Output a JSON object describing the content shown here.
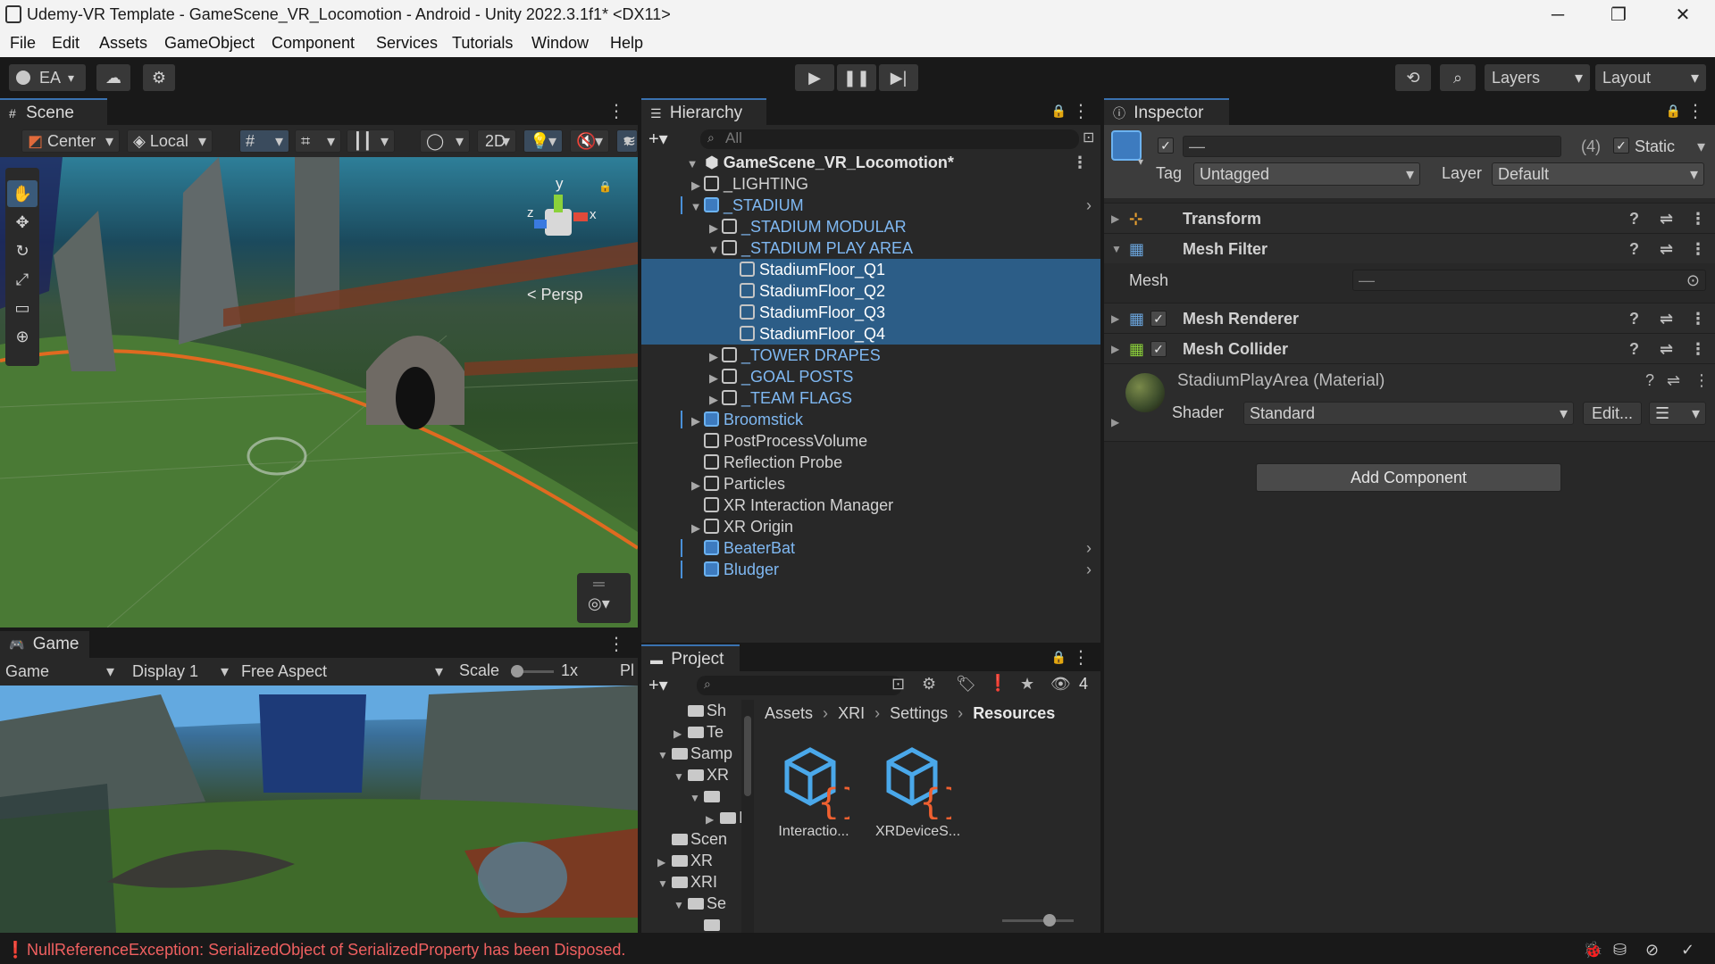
{
  "window": {
    "title": "Udemy-VR Template - GameScene_VR_Locomotion - Android - Unity 2022.3.1f1* <DX11>",
    "minimize": "─",
    "maximize": "❐",
    "close": "✕"
  },
  "menu": [
    "File",
    "Edit",
    "Assets",
    "GameObject",
    "Component",
    "Services",
    "Tutorials",
    "Window",
    "Help"
  ],
  "toolbar": {
    "account": "EA",
    "layers": "Layers",
    "layout": "Layout"
  },
  "scene": {
    "tab": "Scene",
    "pivot": "Center",
    "space": "Local",
    "mode_2d": "2D",
    "persp": "< Persp",
    "axis_y": "y",
    "axis_x": "x",
    "axis_z": "z"
  },
  "game": {
    "tab": "Game",
    "view": "Game",
    "display": "Display 1",
    "aspect": "Free Aspect",
    "scale_label": "Scale",
    "scale_value": "1x",
    "play_label": "Pl"
  },
  "hierarchy": {
    "tab": "Hierarchy",
    "search_placeholder": "All",
    "scene": "GameScene_VR_Locomotion*",
    "items": [
      {
        "label": "_LIGHTING",
        "indent": 1,
        "arrow": "▶",
        "color": "#d2d2d2",
        "blue": false,
        "sel": false,
        "more": false
      },
      {
        "label": "_STADIUM",
        "indent": 1,
        "arrow": "▼",
        "color": "#7fb8f2",
        "blue": true,
        "sel": false,
        "more": true
      },
      {
        "label": "_STADIUM MODULAR",
        "indent": 2,
        "arrow": "▶",
        "color": "#7fb8f2",
        "blue": false,
        "sel": false,
        "more": false
      },
      {
        "label": "_STADIUM PLAY AREA",
        "indent": 2,
        "arrow": "▼",
        "color": "#7fb8f2",
        "blue": false,
        "sel": false,
        "more": false
      },
      {
        "label": "StadiumFloor_Q1",
        "indent": 3,
        "arrow": "",
        "color": "#ffffff",
        "blue": false,
        "sel": true,
        "more": false
      },
      {
        "label": "StadiumFloor_Q2",
        "indent": 3,
        "arrow": "",
        "color": "#ffffff",
        "blue": false,
        "sel": true,
        "more": false
      },
      {
        "label": "StadiumFloor_Q3",
        "indent": 3,
        "arrow": "",
        "color": "#ffffff",
        "blue": false,
        "sel": true,
        "more": false
      },
      {
        "label": "StadiumFloor_Q4",
        "indent": 3,
        "arrow": "",
        "color": "#ffffff",
        "blue": false,
        "sel": true,
        "more": false
      },
      {
        "label": "_TOWER DRAPES",
        "indent": 2,
        "arrow": "▶",
        "color": "#7fb8f2",
        "blue": false,
        "sel": false,
        "more": false
      },
      {
        "label": "_GOAL POSTS",
        "indent": 2,
        "arrow": "▶",
        "color": "#7fb8f2",
        "blue": false,
        "sel": false,
        "more": false
      },
      {
        "label": "_TEAM FLAGS",
        "indent": 2,
        "arrow": "▶",
        "color": "#7fb8f2",
        "blue": false,
        "sel": false,
        "more": false
      },
      {
        "label": "Broomstick",
        "indent": 1,
        "arrow": "▶",
        "color": "#7fb8f2",
        "blue": true,
        "sel": false,
        "more": false
      },
      {
        "label": "PostProcessVolume",
        "indent": 1,
        "arrow": "",
        "color": "#d2d2d2",
        "blue": false,
        "sel": false,
        "more": false
      },
      {
        "label": "Reflection Probe",
        "indent": 1,
        "arrow": "",
        "color": "#d2d2d2",
        "blue": false,
        "sel": false,
        "more": false
      },
      {
        "label": "Particles",
        "indent": 1,
        "arrow": "▶",
        "color": "#d2d2d2",
        "blue": false,
        "sel": false,
        "more": false
      },
      {
        "label": "XR Interaction Manager",
        "indent": 1,
        "arrow": "",
        "color": "#d2d2d2",
        "blue": false,
        "sel": false,
        "more": false
      },
      {
        "label": "XR Origin",
        "indent": 1,
        "arrow": "▶",
        "color": "#d2d2d2",
        "blue": false,
        "sel": false,
        "more": false
      },
      {
        "label": "BeaterBat",
        "indent": 1,
        "arrow": "",
        "color": "#7fb8f2",
        "blue": true,
        "sel": false,
        "more": true
      },
      {
        "label": "Bludger",
        "indent": 1,
        "arrow": "",
        "color": "#7fb8f2",
        "blue": true,
        "sel": false,
        "more": true
      }
    ]
  },
  "inspector": {
    "tab": "Inspector",
    "name_value": "—",
    "count": "(4)",
    "static_label": "Static",
    "tag_label": "Tag",
    "tag_value": "Untagged",
    "layer_label": "Layer",
    "layer_value": "Default",
    "components": [
      "Transform",
      "Mesh Filter",
      "Mesh Renderer",
      "Mesh Collider"
    ],
    "mesh_label": "Mesh",
    "mesh_value": "—",
    "material_name": "StadiumPlayArea (Material)",
    "shader_label": "Shader",
    "shader_value": "Standard",
    "edit_label": "Edit...",
    "add_component": "Add Component"
  },
  "project": {
    "tab": "Project",
    "hidden_count": "4",
    "breadcrumb": [
      "Assets",
      "XRI",
      "Settings",
      "Resources"
    ],
    "tree": [
      {
        "label": "Sh",
        "indent": 2,
        "arrow": ""
      },
      {
        "label": "Te",
        "indent": 2,
        "arrow": "▶"
      },
      {
        "label": "Samp",
        "indent": 1,
        "arrow": "▼"
      },
      {
        "label": "XR",
        "indent": 2,
        "arrow": "▼"
      },
      {
        "label": "",
        "indent": 3,
        "arrow": "▼"
      },
      {
        "label": "I",
        "indent": 4,
        "arrow": "▶"
      },
      {
        "label": "Scen",
        "indent": 1,
        "arrow": ""
      },
      {
        "label": "XR",
        "indent": 1,
        "arrow": "▶"
      },
      {
        "label": "XRI",
        "indent": 1,
        "arrow": "▼"
      },
      {
        "label": "Se",
        "indent": 2,
        "arrow": "▼"
      },
      {
        "label": "",
        "indent": 3,
        "arrow": ""
      }
    ],
    "assets": [
      "Interactio...",
      "XRDeviceS..."
    ]
  },
  "status": {
    "message": "NullReferenceException: SerializedObject of SerializedProperty has been Disposed."
  },
  "colors": {
    "accent": "#3a72b0",
    "selection": "#2c5d87",
    "prefab_blue": "#7fb8f2",
    "error": "#f06060"
  }
}
